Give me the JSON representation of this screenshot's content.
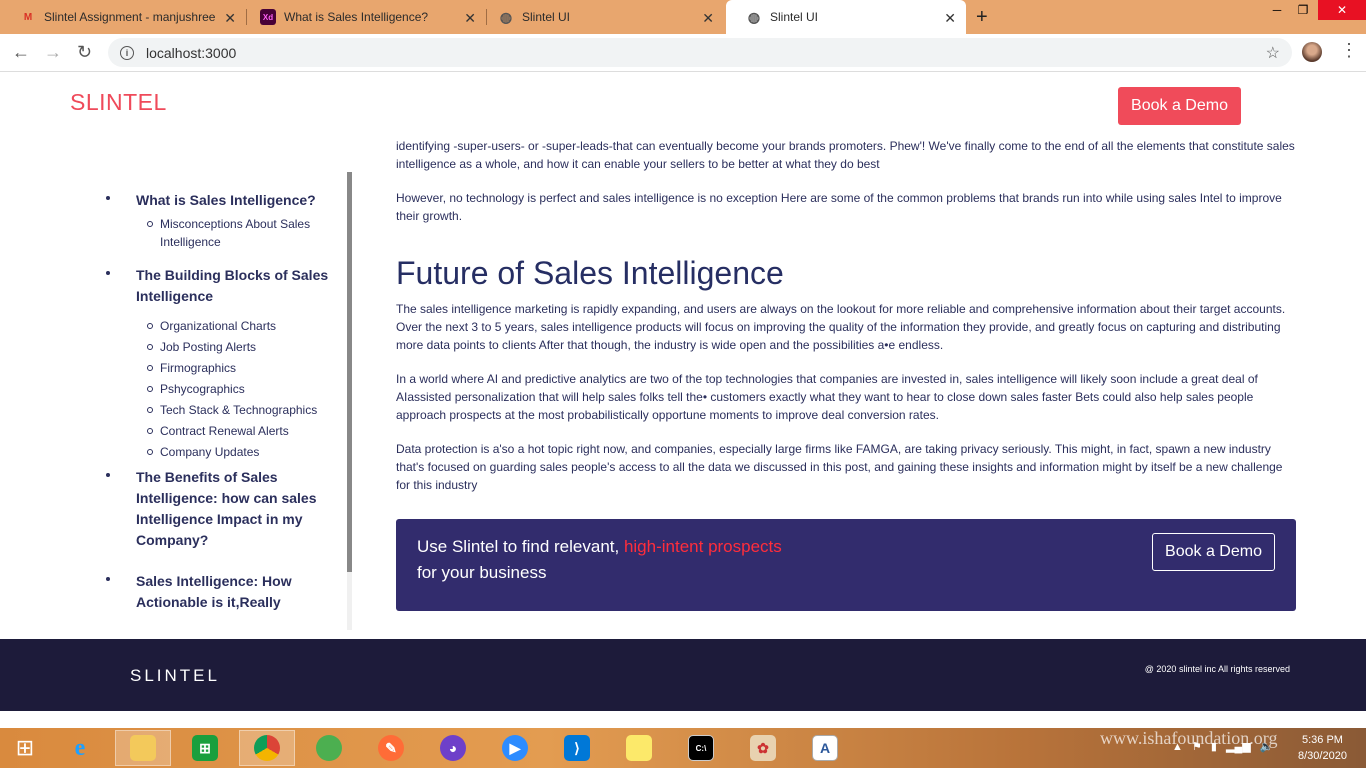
{
  "browser": {
    "tabs": [
      {
        "title": "Slintel Assignment - manjushree",
        "icon": "gmail-icon"
      },
      {
        "title": "What is Sales Intelligence?",
        "icon": "xd-icon"
      },
      {
        "title": "Slintel UI",
        "icon": "globe-icon"
      },
      {
        "title": "Slintel UI",
        "icon": "globe-icon",
        "active": true
      }
    ],
    "url": "localhost:3000"
  },
  "header": {
    "logo": "SLINTEL",
    "book_demo": "Book a Demo"
  },
  "sidebar": {
    "items": [
      {
        "title": "What is Sales Intelligence?",
        "subs": [
          "Misconceptions About Sales Intelligence"
        ]
      },
      {
        "title": "The Building Blocks of Sales Intelligence",
        "subs": [
          "Organizational Charts",
          "Job Posting Alerts",
          "Firmographics",
          "Pshycographics",
          "Tech Stack & Technographics",
          "Contract Renewal Alerts",
          "Company Updates"
        ]
      },
      {
        "title": "The Benefits of Sales Intelligence: how can sales Intelligence Impact in my Company?",
        "subs": []
      },
      {
        "title": "Sales Intelligence: How Actionable is it,Really",
        "subs": []
      }
    ]
  },
  "article": {
    "p0": "identifying -super-users- or -super-leads-that can eventually become your brands promoters. Phew'! We've finally come to the end of all the elements that constitute sales intelligence as a whole, and how it can enable your sellers to be better at what they do best",
    "p1": "However, no technology is perfect and sales intelligence is no exception Here are some of the common problems that brands run into while using sales Intel to improve their growth.",
    "heading": "Future of Sales Intelligence",
    "p2": "The sales intelligence marketing is rapidly expanding, and users are always on the lookout for more reliable and comprehensive information about their target accounts. Over the next 3 to 5 years, sales intelligence products will focus on improving the quality of the information they provide, and greatly focus on capturing and distributing more data points to clients After that though, the industry is wide open and the possibilities a•e endless.",
    "p3": "In a world where AI and predictive analytics are two of the top technologies that companies are invested in, sales intelligence will likely soon include a great deal of AIassisted personalization that will help sales folks tell the• customers exactly what they want to hear to close down sales faster Bets could also help sales people approach prospects at the most probabilistically opportune moments to improve deal conversion rates.",
    "p4": "Data protection is a'so a hot topic right now, and companies, especially large firms like FAMGA, are taking privacy seriously. This might, in fact, spawn a new industry that's focused on guarding sales people's access to all the data we discussed in this post, and gaining these insights and information might by itself be a new challenge for this industry"
  },
  "cta": {
    "text_a": "Use Slintel to find relevant, ",
    "text_highlight": "high-intent prospects",
    "text_b": "for your business",
    "button": "Book a Demo"
  },
  "footer": {
    "logo": "SLINTEL",
    "copyright": "@ 2020 slintel inc All rights reserved"
  },
  "taskbar": {
    "watermark": "www.ishafoundation.org",
    "time": "5:36 PM",
    "date": "8/30/2020"
  },
  "colors": {
    "brand_red": "#f04b5a",
    "navy": "#2b2f5c",
    "cta_bg": "#322c6d",
    "footer_bg": "#1d1b3a",
    "highlight": "#ff2d3b"
  }
}
